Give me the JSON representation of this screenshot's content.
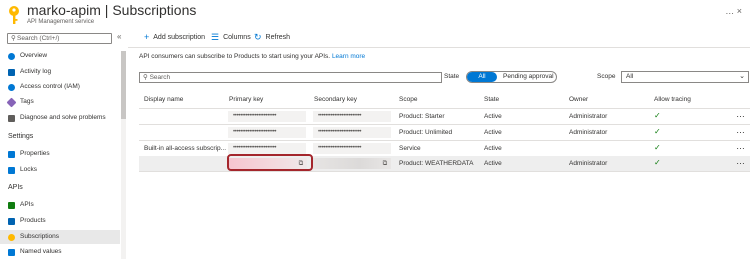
{
  "header": {
    "title": "marko-apim | Subscriptions",
    "subtitle": "API Management service",
    "actions": "…  ×"
  },
  "sidebar": {
    "search_placeholder": "Search (Ctrl+/)",
    "collapse_glyph": "«",
    "items": [
      {
        "label": "Overview",
        "color": "#0078d4"
      },
      {
        "label": "Activity log",
        "color": "#0063b1"
      },
      {
        "label": "Access control (IAM)",
        "color": "#0078d4"
      },
      {
        "label": "Tags",
        "color": "#8764b8"
      },
      {
        "label": "Diagnose and solve problems",
        "color": "#605e5c"
      }
    ],
    "section_settings": "Settings",
    "settings_items": [
      {
        "label": "Properties",
        "color": "#0078d4"
      },
      {
        "label": "Locks",
        "color": "#0078d4"
      }
    ],
    "section_apis": "APIs",
    "api_items": [
      {
        "label": "APIs",
        "color": "#107c10"
      },
      {
        "label": "Products",
        "color": "#0063b1"
      },
      {
        "label": "Subscriptions",
        "color": "#ffb900",
        "selected": true
      },
      {
        "label": "Named values",
        "color": "#0078d4"
      }
    ]
  },
  "toolbar": {
    "add_label": "Add subscription",
    "columns_label": "Columns",
    "refresh_label": "Refresh"
  },
  "info": {
    "text": "API consumers can subscribe to Products to start using your APIs.",
    "link": "Learn more"
  },
  "filters": {
    "search_placeholder": "Search",
    "state_label": "State",
    "state_all": "All",
    "state_pending": "Pending approval",
    "scope_label": "Scope",
    "scope_value": "All"
  },
  "table": {
    "columns": [
      "Display name",
      "Primary key",
      "Secondary key",
      "Scope",
      "State",
      "Owner",
      "Allow tracing"
    ],
    "rows": [
      {
        "display": "",
        "primary": "••••••••••••••••••••••••",
        "secondary": "••••••••••••••••••••••••",
        "scope": "Product: Starter",
        "state": "Active",
        "owner": "Administrator",
        "tracing": "✓",
        "more": "…"
      },
      {
        "display": "",
        "primary": "••••••••••••••••••••••••",
        "secondary": "••••••••••••••••••••••••",
        "scope": "Product: Unlimited",
        "state": "Active",
        "owner": "Administrator",
        "tracing": "✓",
        "more": "…"
      },
      {
        "display": "Built-in all-access subscrip...",
        "primary": "••••••••••••••••••••••••",
        "secondary": "••••••••••••••••••••••••",
        "scope": "Service",
        "state": "Active",
        "owner": "",
        "tracing": "✓",
        "more": "…"
      },
      {
        "display": "",
        "primary": "",
        "secondary": "",
        "scope": "Product: WEATHERDATA",
        "state": "Active",
        "owner": "Administrator",
        "tracing": "✓",
        "more": "…"
      }
    ],
    "copy_glyph": "⧉"
  },
  "colors": {
    "accent": "#0078d4",
    "highlight_border": "#a4262c",
    "check": "#107c10"
  }
}
